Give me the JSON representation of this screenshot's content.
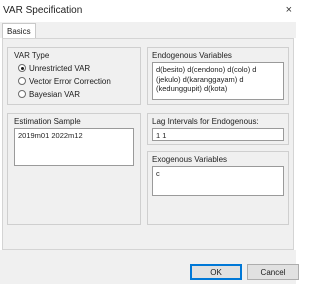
{
  "window": {
    "title": "VAR Specification",
    "close_glyph": "×"
  },
  "tabs": [
    {
      "label": "Basics"
    }
  ],
  "var_type": {
    "title": "VAR Type",
    "options": [
      {
        "label": "Unrestricted VAR",
        "selected": true
      },
      {
        "label": "Vector Error Correction",
        "selected": false
      },
      {
        "label": "Bayesian VAR",
        "selected": false
      }
    ]
  },
  "estimation_sample": {
    "title": "Estimation Sample",
    "value": "2019m01 2022m12"
  },
  "endogenous": {
    "title": "Endogenous Variables",
    "value": "d(besito) d(cendono) d(colo) d\n(jekulo) d(karanggayam) d\n(kedunggupit) d(kota)"
  },
  "lag_intervals": {
    "title": "Lag Intervals for Endogenous:",
    "value": "1 1"
  },
  "exogenous": {
    "title": "Exogenous Variables",
    "value": "c"
  },
  "buttons": {
    "ok": "OK",
    "cancel": "Cancel"
  }
}
